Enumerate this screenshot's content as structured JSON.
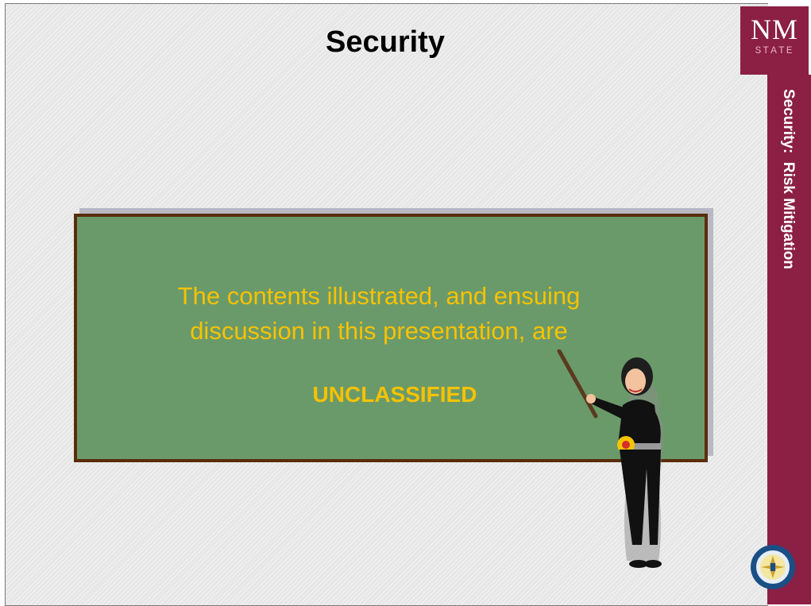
{
  "slide": {
    "title": "Security",
    "sidebar_title": "Security:  Risk Mitigation",
    "logo_text": "NM",
    "logo_subtext": "STATE",
    "board": {
      "message": "The contents illustrated, and ensuing discussion in this presentation, are",
      "classification": "UNCLASSIFIED"
    }
  },
  "colors": {
    "sidebar": "#8b1f44",
    "board_green": "#6b9a6a",
    "board_frame": "#5a2d0c",
    "board_text": "#f7c200"
  },
  "icons": {
    "logo": "nm-state-logo",
    "seal": "university-seal-icon",
    "clipart": "teacher-with-pointer-clipart"
  }
}
